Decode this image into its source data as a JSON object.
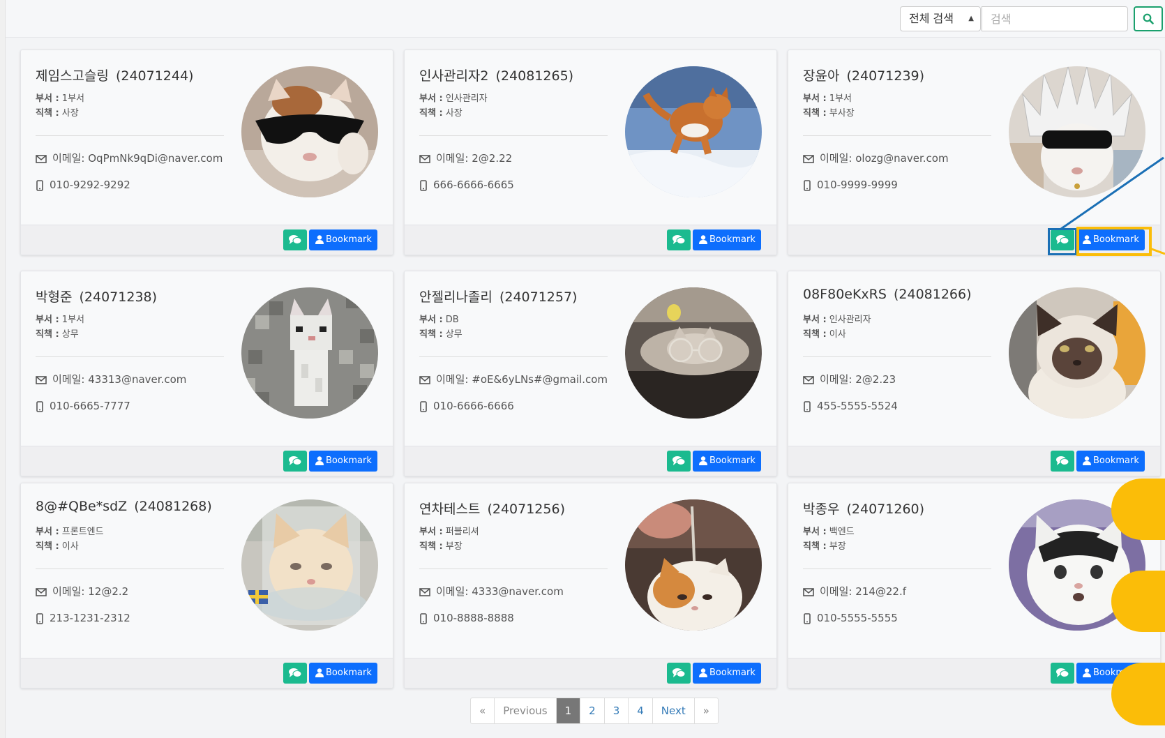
{
  "search": {
    "scope": "전체 검색",
    "placeholder": "검색"
  },
  "labels": {
    "dept": "부서 :",
    "position": "직책 :",
    "email": "이메일:",
    "bookmark": "Bookmark"
  },
  "cards": [
    {
      "name": "제임스고슬링",
      "id": "(24071244)",
      "dept": "1부서",
      "position": "사장",
      "email": "OqPmNk9qDi@naver.com",
      "phone": "010-9292-9292"
    },
    {
      "name": "인사관리자2",
      "id": "(24081265)",
      "dept": "인사관리자",
      "position": "사장",
      "email": "2@2.22",
      "phone": "666-6666-6665"
    },
    {
      "name": "장윤아",
      "id": "(24071239)",
      "dept": "1부서",
      "position": "부사장",
      "email": "olozg@naver.com",
      "phone": "010-9999-9999"
    },
    {
      "name": "박형준",
      "id": "(24071238)",
      "dept": "1부서",
      "position": "상무",
      "email": "43313@naver.com",
      "phone": "010-6665-7777"
    },
    {
      "name": "안젤리나졸리",
      "id": "(24071257)",
      "dept": "DB",
      "position": "상무",
      "email": "#oE&6yLNs#@gmail.com",
      "phone": "010-6666-6666"
    },
    {
      "name": "08F80eKxRS",
      "id": "(24081266)",
      "dept": "인사관리자",
      "position": "이사",
      "email": "2@2.23",
      "phone": "455-5555-5524"
    },
    {
      "name": "8@#QBe*sdZ",
      "id": "(24081268)",
      "dept": "프론트엔드",
      "position": "이사",
      "email": "12@2.2",
      "phone": "213-1231-2312"
    },
    {
      "name": "연차테스트",
      "id": "(24071256)",
      "dept": "퍼블리셔",
      "position": "부장",
      "email": "4333@naver.com",
      "phone": "010-8888-8888"
    },
    {
      "name": "박종우",
      "id": "(24071260)",
      "dept": "백엔드",
      "position": "부장",
      "email": "214@22.f",
      "phone": "010-5555-5555"
    }
  ],
  "pagination": {
    "first": "«",
    "previous": "Previous",
    "pages": [
      "1",
      "2",
      "3",
      "4"
    ],
    "active": "1",
    "next": "Next",
    "last": "»"
  },
  "colors": {
    "chat": "#1bba8f",
    "bookmark": "#0d6efd",
    "highlight": "#fbbd08",
    "annotation_line": "#1a6fb5",
    "search_button_border": "#1aa06d"
  },
  "icons": {
    "email": "envelope-icon",
    "phone": "mobile-phone-icon",
    "chat": "chat-bubbles-icon",
    "bookmark": "user-icon",
    "search": "search-icon"
  }
}
